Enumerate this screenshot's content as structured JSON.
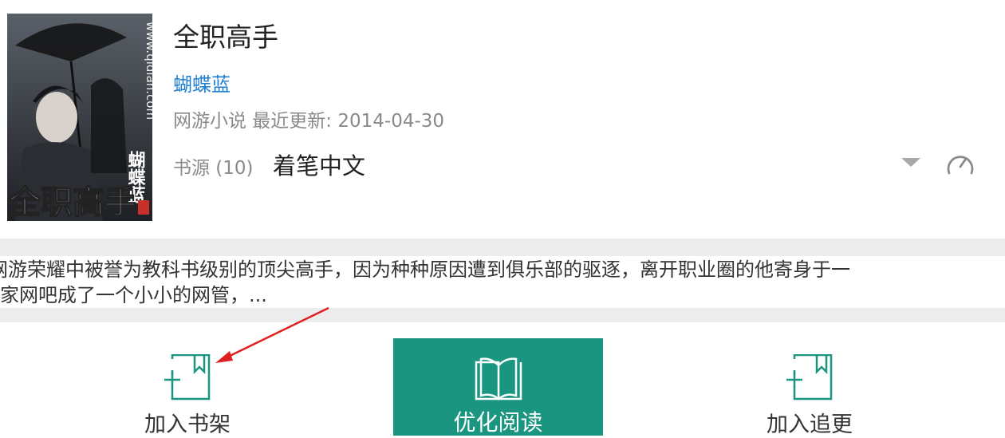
{
  "book": {
    "title": "全职高手",
    "author": "蝴蝶蓝",
    "meta": "网游小说 最近更新: 2014-04-30",
    "source_label": "书源 (10)",
    "source_name": "着笔中文",
    "cover_url_text": "www.qidian.com",
    "cover_title_text": "全职高手",
    "cover_author_text": "蝴蝶蓝"
  },
  "description": {
    "line1": "网游荣耀中被誉为教科书级别的顶尖高手，因为种种原因遭到俱乐部的驱逐，离开职业圈的他寄身于一",
    "line2": "家网吧成了一个小小的网管，..."
  },
  "actions": {
    "add_shelf": "加入书架",
    "optimize_read": "优化阅读",
    "add_follow": "加入追更"
  },
  "colors": {
    "accent": "#1a9580",
    "author_link": "#1f7fd0",
    "annotation_arrow": "#e02020"
  },
  "icons": {
    "dropdown": "caret-down-icon",
    "speed": "speedometer-icon",
    "shelf": "bookmark-plus-icon",
    "read": "open-book-icon",
    "follow": "bookmark-plus-icon"
  }
}
